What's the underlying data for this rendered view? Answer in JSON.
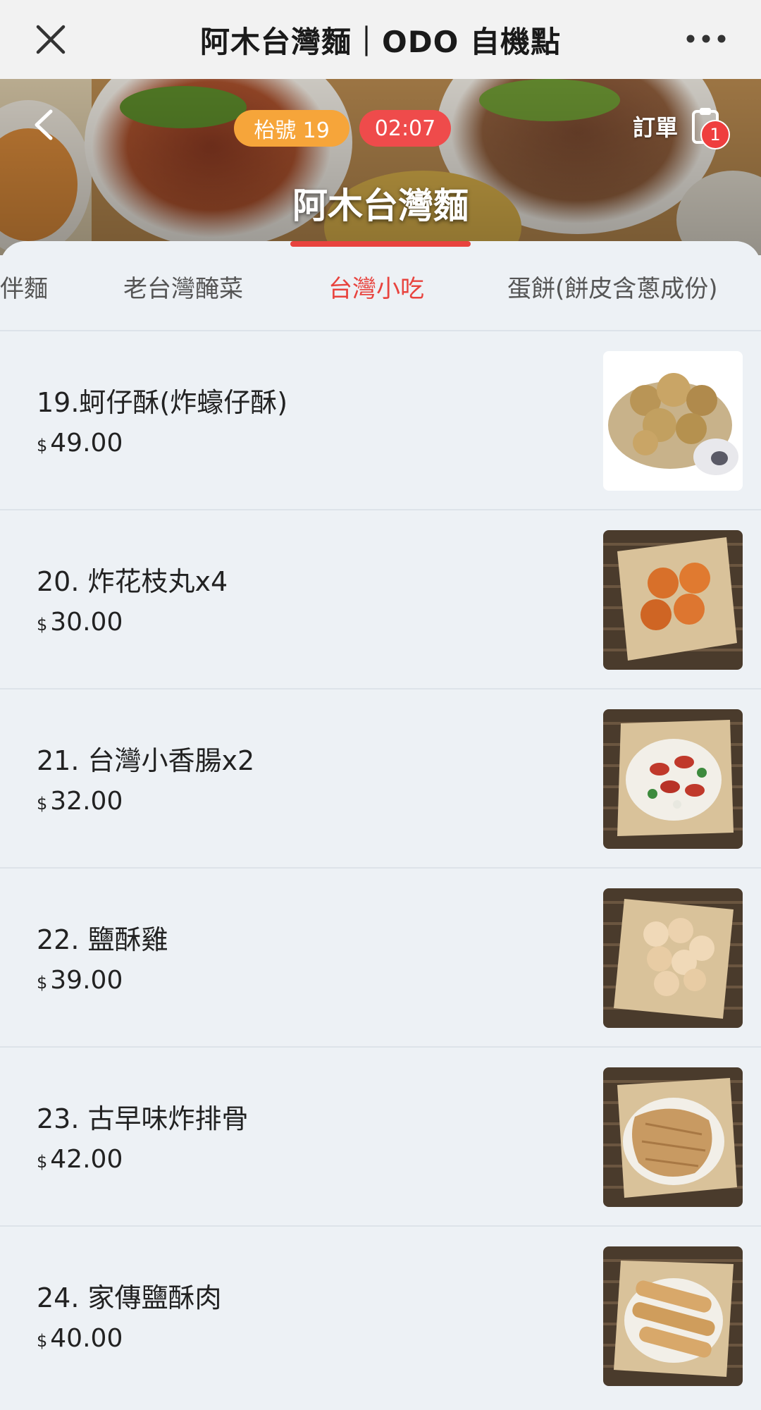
{
  "topbar": {
    "title": "阿木台灣麵｜ODO 自機點",
    "close_icon": "close-icon",
    "more_icon": "more-icon"
  },
  "header": {
    "table_label": "枱號 19",
    "timer": "02:07",
    "order_label": "訂單",
    "order_count": "1",
    "store_name": "阿木台灣麵"
  },
  "tabs": [
    {
      "label": "伴麵"
    },
    {
      "label": "老台灣醃菜"
    },
    {
      "label": "台灣小吃",
      "active": true
    },
    {
      "label": "蛋餅(餅皮含蔥成份)"
    }
  ],
  "items": [
    {
      "name": "19.蚵仔酥(炸蠔仔酥)",
      "currency": "$",
      "price": "49.00"
    },
    {
      "name": "20. 炸花枝丸x4",
      "currency": "$",
      "price": "30.00"
    },
    {
      "name": "21. 台灣小香腸x2",
      "currency": "$",
      "price": "32.00"
    },
    {
      "name": "22. 鹽酥雞",
      "currency": "$",
      "price": "39.00"
    },
    {
      "name": "23. 古早味炸排骨",
      "currency": "$",
      "price": "42.00"
    },
    {
      "name": "24. 家傳鹽酥肉",
      "currency": "$",
      "price": "40.00"
    }
  ],
  "colors": {
    "accent": "#e8433e",
    "table_badge": "#f6a53a",
    "timer_badge": "#ef4b4b",
    "background": "#edf1f5"
  }
}
